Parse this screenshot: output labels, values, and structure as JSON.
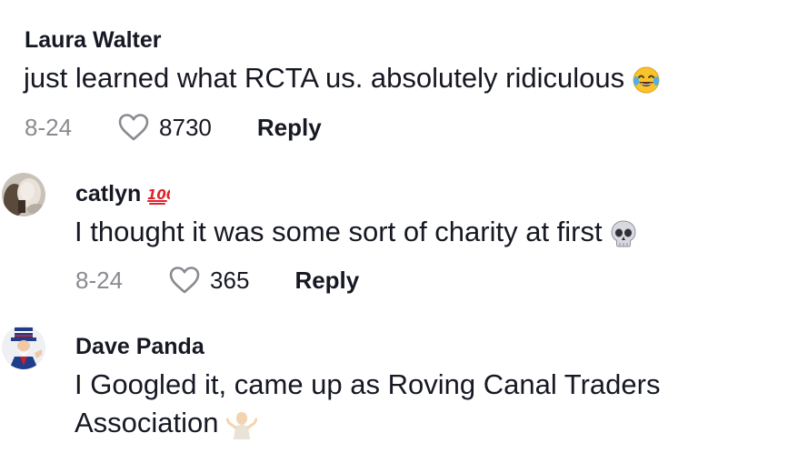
{
  "comments": [
    {
      "username": "Laura Walter",
      "text": "just learned what RCTA us. absolutely ridiculous",
      "emoji_icon": "face-with-tears-of-joy-icon",
      "date": "8-24",
      "likes": "8730",
      "reply_label": "Reply"
    },
    {
      "username": "catlyn",
      "username_emoji_icon": "hundred-points-icon",
      "text": "I thought it was some sort of charity at first",
      "emoji_icon": "skull-icon",
      "date": "8-24",
      "likes": "365",
      "reply_label": "Reply"
    },
    {
      "username": "Dave Panda",
      "text_line1": "I Googled it, came up as Roving Canal Traders",
      "text_line2": "Association",
      "emoji_icon": "person-shrugging-icon"
    }
  ],
  "colors": {
    "text": "#161823",
    "meta": "#8a8b91",
    "heart": "#8a8b91"
  }
}
